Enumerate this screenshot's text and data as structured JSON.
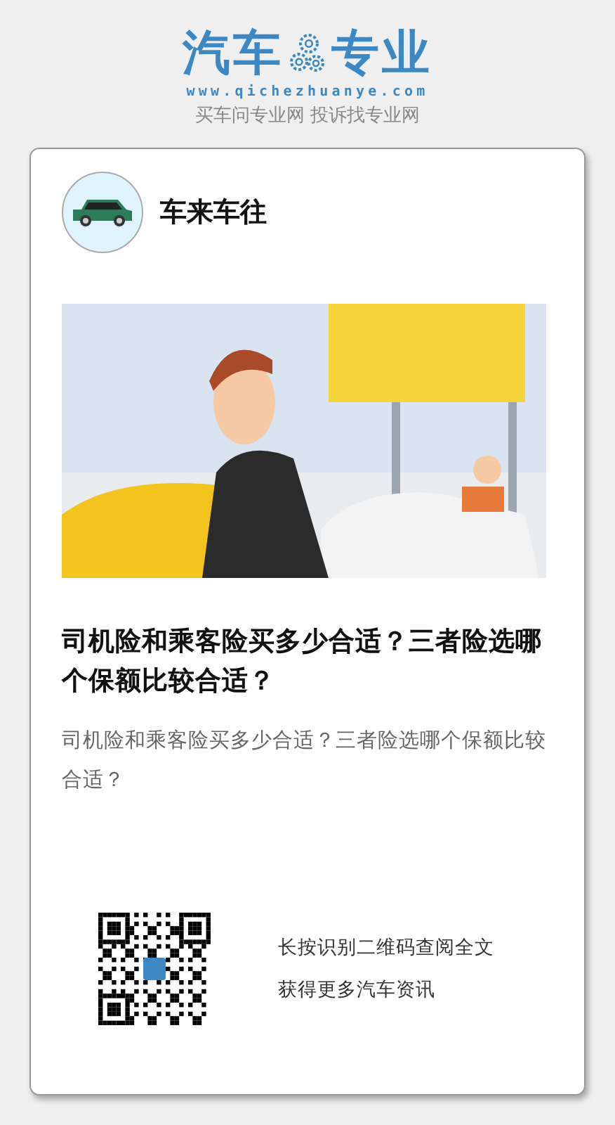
{
  "logo": {
    "left": "汽车",
    "right": "专业",
    "url": "www.qichezhuanye.com",
    "slogan": "买车问专业网 投诉找专业网"
  },
  "card": {
    "author": "车来车往",
    "title": "司机险和乘客险买多少合适？三者险选哪个保额比较合适？",
    "summary": "司机险和乘客险买多少合适？三者险选哪个保额比较合适？",
    "qr_lines": [
      "长按识别二维码查阅全文",
      "获得更多汽车资讯"
    ]
  }
}
